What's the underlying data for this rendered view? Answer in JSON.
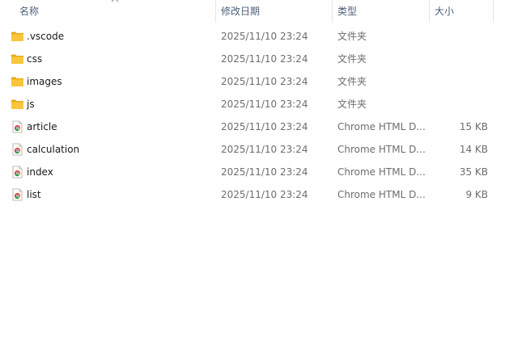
{
  "columns": {
    "name": "名称",
    "date": "修改日期",
    "type": "类型",
    "size": "大小"
  },
  "files": [
    {
      "name": ".vscode",
      "date": "2025/11/10 23:24",
      "type": "文件夹",
      "size": "",
      "icon": "folder-icon"
    },
    {
      "name": "css",
      "date": "2025/11/10 23:24",
      "type": "文件夹",
      "size": "",
      "icon": "folder-icon"
    },
    {
      "name": "images",
      "date": "2025/11/10 23:24",
      "type": "文件夹",
      "size": "",
      "icon": "folder-icon"
    },
    {
      "name": "js",
      "date": "2025/11/10 23:24",
      "type": "文件夹",
      "size": "",
      "icon": "folder-icon"
    },
    {
      "name": "article",
      "date": "2025/11/10 23:24",
      "type": "Chrome HTML D...",
      "size": "15 KB",
      "icon": "chrome-html-file-icon"
    },
    {
      "name": "calculation",
      "date": "2025/11/10 23:24",
      "type": "Chrome HTML D...",
      "size": "14 KB",
      "icon": "chrome-html-file-icon"
    },
    {
      "name": "index",
      "date": "2025/11/10 23:24",
      "type": "Chrome HTML D...",
      "size": "35 KB",
      "icon": "chrome-html-file-icon"
    },
    {
      "name": "list",
      "date": "2025/11/10 23:24",
      "type": "Chrome HTML D...",
      "size": "9 KB",
      "icon": "chrome-html-file-icon"
    }
  ],
  "colors": {
    "header_text": "#4c607a",
    "folder_yellow": "#f8c63d",
    "folder_dark": "#e6a917",
    "secondary_text": "#6d6d6d"
  }
}
